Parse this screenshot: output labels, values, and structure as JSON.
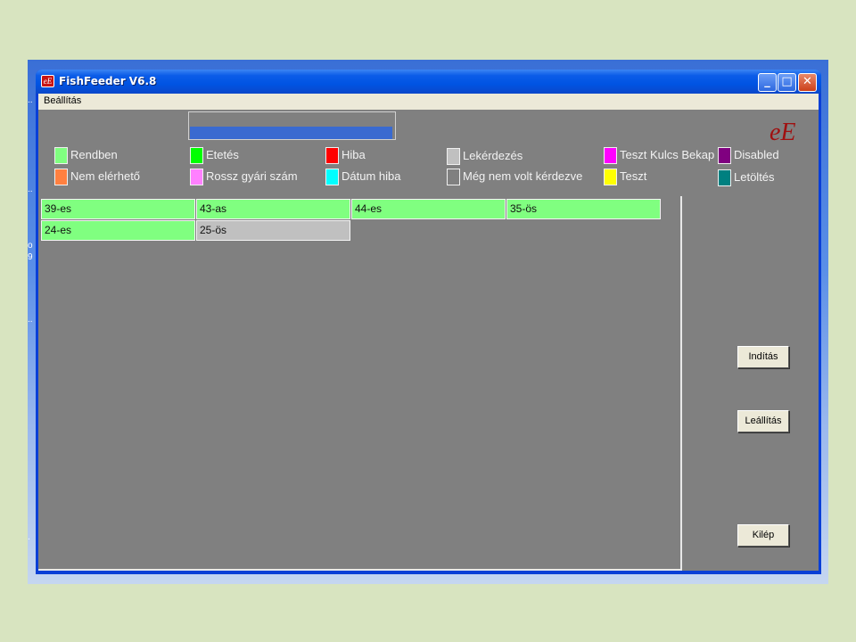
{
  "window": {
    "title": "FishFeeder V6.8",
    "icon": "eE",
    "controls": {
      "minimize": "_",
      "maximize": "□",
      "close": "✕"
    }
  },
  "menu": {
    "items": [
      {
        "label": "Beállítás"
      }
    ]
  },
  "progress": {
    "fraction": 0.99
  },
  "logo": "eE",
  "legend": [
    {
      "label": "Rendben",
      "color": "#80ff80"
    },
    {
      "label": "Etetés",
      "color": "#00ff00"
    },
    {
      "label": "Hiba",
      "color": "#ff0000"
    },
    {
      "label": "Lekérdezés",
      "color": "#c0c0c0"
    },
    {
      "label": "Teszt Kulcs Bekap",
      "color": "#ff00ff"
    },
    {
      "label": "Disabled",
      "color": "#800080"
    },
    {
      "label": "Nem elérhető",
      "color": "#ff8040"
    },
    {
      "label": "Rossz gyári szám",
      "color": "#ff80ff"
    },
    {
      "label": "Dátum hiba",
      "color": "#00ffff"
    },
    {
      "label": "Még nem volt kérdezve",
      "color": "#808080"
    },
    {
      "label": "Teszt",
      "color": "#ffff00"
    },
    {
      "label": "Letöltés",
      "color": "#008080"
    }
  ],
  "cells": [
    {
      "label": "39-es",
      "color": "#80ff80"
    },
    {
      "label": "43-as",
      "color": "#80ff80"
    },
    {
      "label": "44-es",
      "color": "#80ff80"
    },
    {
      "label": "35-ös",
      "color": "#80ff80"
    },
    {
      "label": "24-es",
      "color": "#80ff80"
    },
    {
      "label": "25-ös",
      "color": "#c0c0c0"
    }
  ],
  "buttons": {
    "start": "Indítás",
    "stop": "Leállítás",
    "exit": "Kilép"
  },
  "desktop_glyphs": [
    "..",
    "..",
    "o",
    "9",
    "..",
    "."
  ]
}
